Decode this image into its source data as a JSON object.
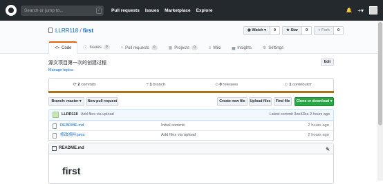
{
  "topbar": {
    "search_placeholder": "Search or jump to...",
    "slash_key": "/",
    "nav": [
      "Pull requests",
      "Issues",
      "Marketplace",
      "Explore"
    ],
    "bell": "🔔",
    "plus": "+▾"
  },
  "repo": {
    "owner": "LLRR118",
    "sep": "/",
    "name": "first",
    "watch_label": "◉ Watch ▾",
    "watch_count": "0",
    "star_label": "★ Star",
    "star_count": "0",
    "fork_label": "⑂ Fork",
    "fork_count": "0"
  },
  "tabs": [
    {
      "icon": "<>",
      "label": "Code",
      "badge": ""
    },
    {
      "icon": "ⓘ",
      "label": "Issues",
      "badge": "0"
    },
    {
      "icon": "⑂",
      "label": "Pull requests",
      "badge": "0"
    },
    {
      "icon": "▦",
      "label": "Projects",
      "badge": "0"
    },
    {
      "icon": "≡",
      "label": "Wiki",
      "badge": ""
    },
    {
      "icon": "▅",
      "label": "Insights",
      "badge": ""
    },
    {
      "icon": "⚙",
      "label": "Settings",
      "badge": ""
    }
  ],
  "description": "源文项目第一次的创建过程",
  "manage_topics": "Manage topics",
  "edit": "Edit",
  "summary": [
    {
      "icon": "⟳",
      "count": "2",
      "label": "commits"
    },
    {
      "icon": "⑂",
      "count": "1",
      "label": "branch"
    },
    {
      "icon": "◇",
      "count": "0",
      "label": "releases"
    },
    {
      "icon": "☺",
      "count": "1",
      "label": "contributor"
    }
  ],
  "lang_color": "#b07219",
  "file_nav": {
    "branch": "Branch: master ▾",
    "new_pr": "New pull request",
    "create_file": "Create new file",
    "upload": "Upload files",
    "find": "Find file",
    "clone": "Clone or download ▾"
  },
  "commit": {
    "author": "LLRR118",
    "message": "Add files via upload",
    "latest": "Latest commit 3ze42ba 2 hours ago"
  },
  "files": [
    {
      "name": "README.md",
      "message": "Initial commit",
      "age": "2 hours ago"
    },
    {
      "name": "修改资料.java",
      "message": "Add files via upload",
      "age": "2 hours ago"
    }
  ],
  "readme": {
    "title": "README.md",
    "heading": "first"
  }
}
